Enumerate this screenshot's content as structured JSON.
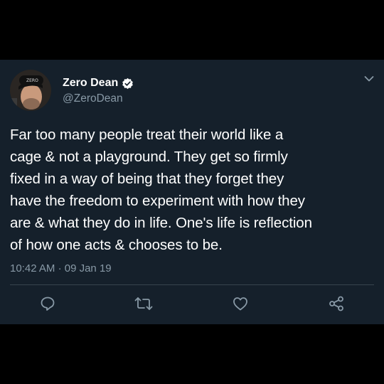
{
  "tweet": {
    "display_name": "Zero Dean",
    "handle": "@ZeroDean",
    "avatar_icon": "profile-photo",
    "verified": true,
    "text_lines": [
      "Far too many people treat their world like a",
      "cage & not a playground. They get so firmly",
      "fixed in a way of being that they forget they",
      "have the freedom to experiment with how they",
      "are & what they do in life. One's life is reflection",
      "of how one acts & chooses to be."
    ],
    "time": "10:42 AM",
    "separator": "·",
    "date": "09 Jan 19"
  },
  "actions": [
    {
      "name": "reply",
      "icon": "reply-icon"
    },
    {
      "name": "retweet",
      "icon": "retweet-icon"
    },
    {
      "name": "like",
      "icon": "heart-icon"
    },
    {
      "name": "share",
      "icon": "share-icon"
    }
  ],
  "colors": {
    "background": "#15202b",
    "text": "#ffffff",
    "secondary": "#8899a6",
    "divider": "#38444d"
  }
}
